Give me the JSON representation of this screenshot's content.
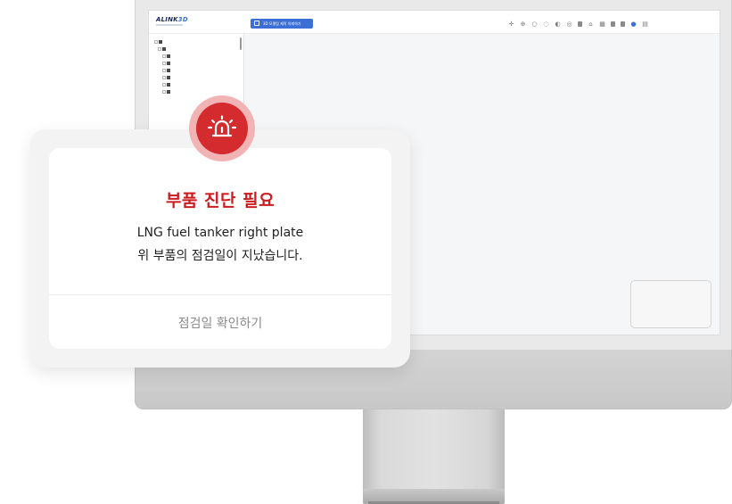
{
  "app": {
    "logo": {
      "main": "ALINK",
      "accent": "3D"
    },
    "top_button_label": "3D 모델링 제작 의뢰하기",
    "toolbar_icons": [
      "move-icon",
      "pan-icon",
      "zoom-icon",
      "orbit-icon",
      "view-icon",
      "rotate-icon",
      "box-icon",
      "home-icon",
      "grid-icon",
      "layer-icon",
      "layer2-icon",
      "eye-icon",
      "panel-icon"
    ]
  },
  "alert": {
    "title": "부품 진단 필요",
    "line1": "LNG fuel tanker right plate",
    "line2": "위 부품의 점검일이 지났습니다.",
    "confirm_label": "점검일 확인하기",
    "icon": "siren-icon"
  },
  "colors": {
    "accent_red": "#d32b2e",
    "title_red": "#cc1b1f",
    "button_blue": "#3b6fd6"
  }
}
